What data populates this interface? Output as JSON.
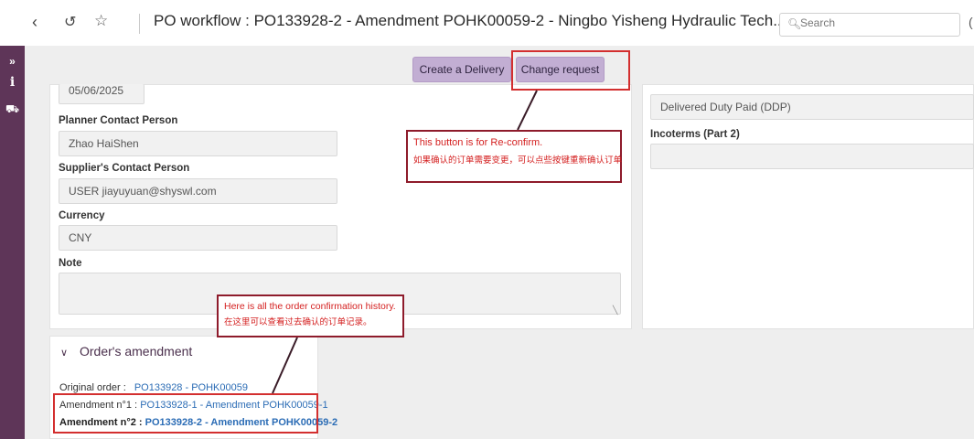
{
  "topbar": {
    "back_icon": "chevron-left-icon",
    "history_icon": "history-icon",
    "star_icon": "star-icon",
    "title": "PO workflow : PO133928-2 - Amendment POHK00059-2 - Ningbo Yisheng Hydraulic Tech...",
    "search_placeholder": "Search",
    "edge_char": "("
  },
  "rail": {
    "items": [
      {
        "icon": "expand-icon",
        "glyph": "»"
      },
      {
        "icon": "info-icon",
        "glyph": "i"
      },
      {
        "icon": "truck-icon",
        "glyph": "⛟"
      }
    ]
  },
  "actions": {
    "create_delivery": "Create a Delivery",
    "change_request": "Change request"
  },
  "form": {
    "date_value": "05/06/2025",
    "planner_label": "Planner Contact Person",
    "planner_value": "Zhao HaiShen",
    "supplier_label": "Supplier's Contact Person",
    "supplier_value": "USER jiayuyuan@shyswl.com",
    "currency_label": "Currency",
    "currency_value": "CNY",
    "note_label": "Note",
    "note_value": ""
  },
  "right_panel": {
    "incoterms_value": "Delivered Duty Paid (DDP)",
    "incoterms2_label": "Incoterms (Part 2)",
    "incoterms2_value": ""
  },
  "callouts": {
    "reconfirm_en": "This button is for Re-confirm.",
    "reconfirm_cn": "如果确认的订单需要变更，可以点些按键重新确认订单",
    "history_en": "Here is all the order confirmation history.",
    "history_cn": "在这里可以查看过去确认的订单记录。"
  },
  "amendments": {
    "title": "Order's amendment",
    "original_label": "Original order :",
    "original_link": "PO133928 - POHK00059",
    "amend1_label": "Amendment n°1 :",
    "amend1_link": "PO133928-1 - Amendment POHK00059-1",
    "amend2_label": "Amendment n°2 :",
    "amend2_link": "PO133928-2 - Amendment POHK00059-2"
  },
  "colors": {
    "rail": "#5e3558",
    "button": "#c2aed3",
    "annotation_red": "#d32f2f",
    "callout_border": "#8e1b2b",
    "link": "#2b6cb5"
  }
}
